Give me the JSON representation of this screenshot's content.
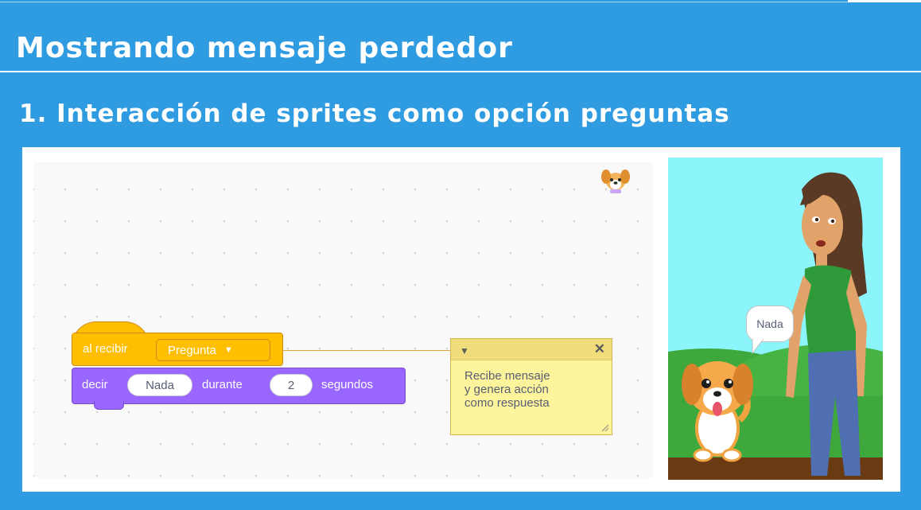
{
  "slide": {
    "title": "Mostrando mensaje perdedor",
    "heading": "1.  Interacción de sprites como opción preguntas"
  },
  "script": {
    "event_block": {
      "label": "al recibir",
      "message_dropdown": "Pregunta",
      "color": "#ffbf00"
    },
    "say_block": {
      "label": "decir",
      "message_value": "Nada",
      "middle_label": "durante",
      "seconds_value": "2",
      "unit_label": "segundos",
      "color": "#9966ff"
    }
  },
  "comment": {
    "text": "Recibe mensaje\ny genera acción\ncomo  respuesta",
    "color": "#fef49c"
  },
  "stage": {
    "speech_bubble_text": "Nada",
    "sky_color": "#8cf5fb",
    "hill_color": "#3ea83c",
    "ground_color": "#6a3b12"
  },
  "icons": [
    "dog-sprite-thumbnail-icon",
    "dropdown-caret-icon",
    "collapse-caret-icon",
    "close-icon",
    "resize-grip-icon"
  ]
}
